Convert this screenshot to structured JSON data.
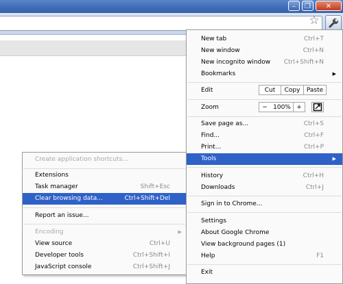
{
  "window": {
    "minimize_glyph": "–",
    "maximize_glyph": "❐",
    "close_glyph": "✕"
  },
  "toolbar": {
    "star_glyph": "☆",
    "star_icon": "star-icon",
    "wrench_icon": "wrench-icon"
  },
  "main_menu": {
    "new_tab": {
      "label": "New tab",
      "shortcut": "Ctrl+T"
    },
    "new_window": {
      "label": "New window",
      "shortcut": "Ctrl+N"
    },
    "new_incognito": {
      "label": "New incognito window",
      "shortcut": "Ctrl+Shift+N"
    },
    "bookmarks": {
      "label": "Bookmarks"
    },
    "edit": {
      "label": "Edit",
      "cut": "Cut",
      "copy": "Copy",
      "paste": "Paste"
    },
    "zoom": {
      "label": "Zoom",
      "minus": "−",
      "value": "100%",
      "plus": "+"
    },
    "save_page": {
      "label": "Save page as...",
      "shortcut": "Ctrl+S"
    },
    "find": {
      "label": "Find...",
      "shortcut": "Ctrl+F"
    },
    "print": {
      "label": "Print...",
      "shortcut": "Ctrl+P"
    },
    "tools": {
      "label": "Tools"
    },
    "history": {
      "label": "History",
      "shortcut": "Ctrl+H"
    },
    "downloads": {
      "label": "Downloads",
      "shortcut": "Ctrl+J"
    },
    "sign_in": {
      "label": "Sign in to Chrome..."
    },
    "settings": {
      "label": "Settings"
    },
    "about": {
      "label": "About Google Chrome"
    },
    "background_pages": {
      "label": "View background pages (1)"
    },
    "help": {
      "label": "Help",
      "shortcut": "F1"
    },
    "exit": {
      "label": "Exit"
    }
  },
  "tools_menu": {
    "create_shortcuts": {
      "label": "Create application shortcuts..."
    },
    "extensions": {
      "label": "Extensions"
    },
    "task_manager": {
      "label": "Task manager",
      "shortcut": "Shift+Esc"
    },
    "clear_browsing": {
      "label": "Clear browsing data...",
      "shortcut": "Ctrl+Shift+Del"
    },
    "report_issue": {
      "label": "Report an issue..."
    },
    "encoding": {
      "label": "Encoding"
    },
    "view_source": {
      "label": "View source",
      "shortcut": "Ctrl+U"
    },
    "developer_tools": {
      "label": "Developer tools",
      "shortcut": "Ctrl+Shift+I"
    },
    "js_console": {
      "label": "JavaScript console",
      "shortcut": "Ctrl+Shift+J"
    }
  },
  "colors": {
    "highlight": "#2f62c8",
    "titlebar": "#3d6bb5",
    "disabled_text": "#a8a8a8"
  }
}
